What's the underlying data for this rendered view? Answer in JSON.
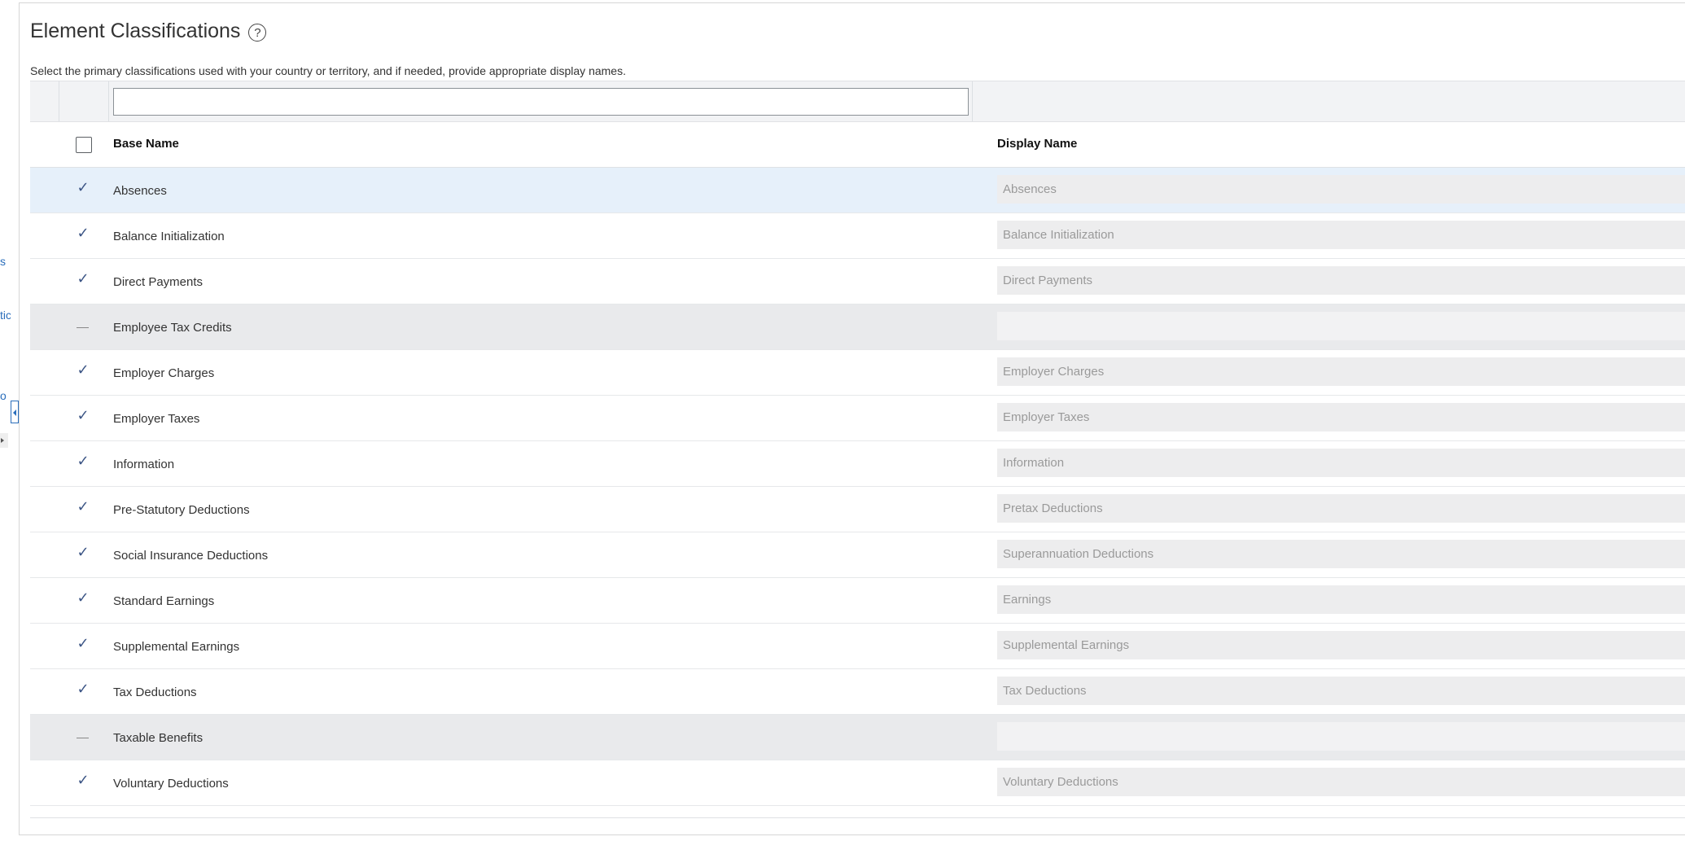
{
  "side_fragments": [
    "s",
    "tic",
    "o"
  ],
  "header": {
    "title": "Element Classifications",
    "help_symbol": "?"
  },
  "instructions": "Select the primary classifications used with your country or territory, and if needed, provide appropriate display names.",
  "filter": {
    "value": "",
    "placeholder": ""
  },
  "columns": {
    "base_name": "Base Name",
    "display_name": "Display Name"
  },
  "rows": [
    {
      "checked": true,
      "base_name": "Absences",
      "display_name": "Absences"
    },
    {
      "checked": true,
      "base_name": "Balance Initialization",
      "display_name": "Balance Initialization"
    },
    {
      "checked": true,
      "base_name": "Direct Payments",
      "display_name": "Direct Payments"
    },
    {
      "checked": false,
      "base_name": "Employee Tax Credits",
      "display_name": ""
    },
    {
      "checked": true,
      "base_name": "Employer Charges",
      "display_name": "Employer Charges"
    },
    {
      "checked": true,
      "base_name": "Employer Taxes",
      "display_name": "Employer Taxes"
    },
    {
      "checked": true,
      "base_name": "Information",
      "display_name": "Information"
    },
    {
      "checked": true,
      "base_name": "Pre-Statutory Deductions",
      "display_name": "Pretax Deductions"
    },
    {
      "checked": true,
      "base_name": "Social Insurance Deductions",
      "display_name": "Superannuation Deductions"
    },
    {
      "checked": true,
      "base_name": "Standard Earnings",
      "display_name": "Earnings"
    },
    {
      "checked": true,
      "base_name": "Supplemental Earnings",
      "display_name": "Supplemental Earnings"
    },
    {
      "checked": true,
      "base_name": "Tax Deductions",
      "display_name": "Tax Deductions"
    },
    {
      "checked": false,
      "base_name": "Taxable Benefits",
      "display_name": ""
    },
    {
      "checked": true,
      "base_name": "Voluntary Deductions",
      "display_name": "Voluntary Deductions"
    }
  ],
  "check_glyph": "✓",
  "colors": {
    "check": "#3c5585",
    "link": "#2a6ebb",
    "selected_row": "#e6f0fa",
    "inactive_row": "#e9eaec"
  }
}
